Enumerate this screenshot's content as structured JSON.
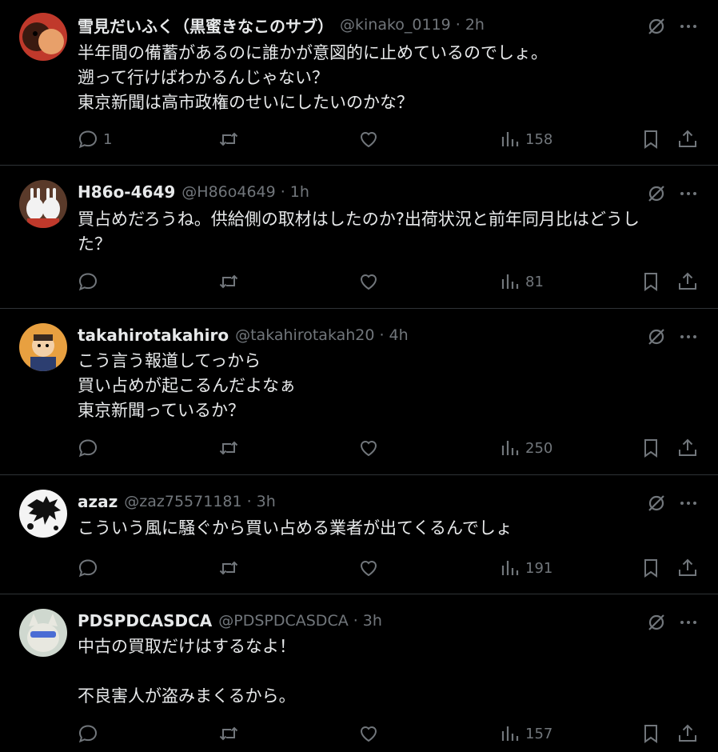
{
  "tweets": [
    {
      "name": "雪見だいふく（黒蜜きなこのサブ）",
      "handle": "@kinako_0119",
      "sep": "·",
      "time": "2h",
      "lines": [
        "半年間の備蓄があるのに誰かが意図的に止めているのでしょ。",
        "遡って行けばわかるんじゃない？",
        "東京新聞は高市政権のせいにしたいのかな？"
      ],
      "replies": "1",
      "views": "158"
    },
    {
      "name": "H86o-4649",
      "handle": "@H86o4649",
      "sep": "·",
      "time": "1h",
      "lines": [
        "買占めだろうね。供給側の取材はしたのか?出荷状況と前年同月比はどうし",
        "た？"
      ],
      "replies": "",
      "views": "81"
    },
    {
      "name": "takahirotakahiro",
      "handle": "@takahirotakah20",
      "sep": "·",
      "time": "4h",
      "lines": [
        "こう言う報道してっから",
        "買い占めが起こるんだよなぁ",
        "東京新聞っているか？"
      ],
      "replies": "",
      "views": "250"
    },
    {
      "name": "azaz",
      "handle": "@zaz75571181",
      "sep": "·",
      "time": "3h",
      "lines": [
        "こういう風に騒ぐから買い占める業者が出てくるんでしょ"
      ],
      "replies": "",
      "views": "191"
    },
    {
      "name": "PDSPDCASDCA",
      "handle": "@PDSPDCASDCA",
      "sep": "·",
      "time": "3h",
      "lines": [
        "中古の買取だけはするなよ！",
        "",
        "不良害人が盗みまくるから。"
      ],
      "replies": "",
      "views": "157"
    }
  ]
}
